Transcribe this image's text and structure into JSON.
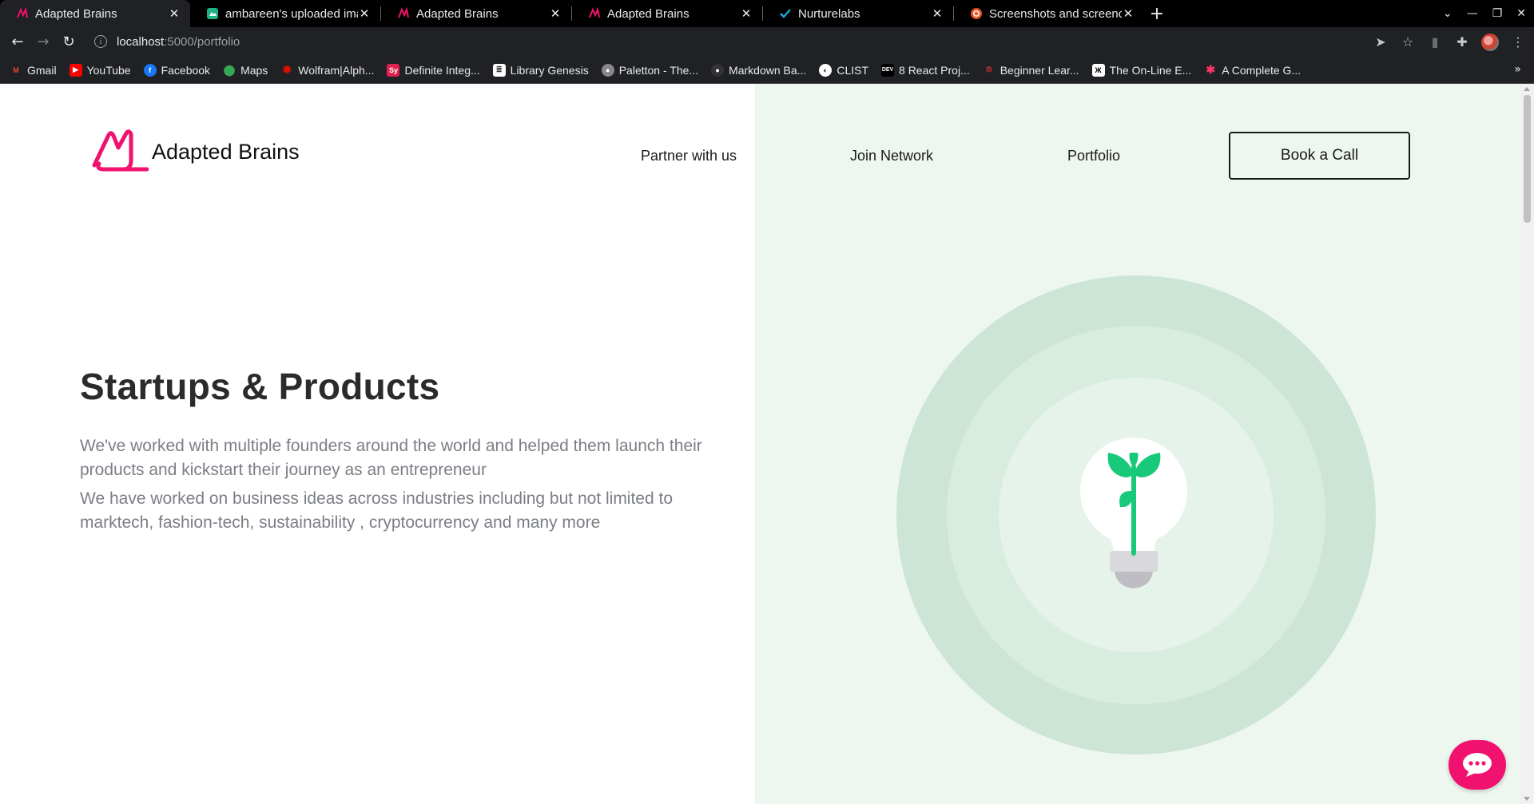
{
  "browser": {
    "tabs": [
      {
        "title": "Adapted Brains",
        "icon": "adapted-brains-icon",
        "active": true
      },
      {
        "title": "ambareen's uploaded ima",
        "icon": "uploaded-images-icon",
        "active": false
      },
      {
        "title": "Adapted Brains",
        "icon": "adapted-brains-icon",
        "active": false
      },
      {
        "title": "Adapted Brains",
        "icon": "adapted-brains-icon",
        "active": false
      },
      {
        "title": "Nurturelabs",
        "icon": "check-icon",
        "active": false
      },
      {
        "title": "Screenshots and screenca",
        "icon": "ubuntu-icon",
        "active": false
      }
    ],
    "url_host": "localhost",
    "url_path": ":5000/portfolio",
    "bookmarks": [
      {
        "label": "Gmail",
        "icon": "gmail-icon",
        "color": "#ea4335"
      },
      {
        "label": "YouTube",
        "icon": "youtube-icon",
        "color": "#ff0000"
      },
      {
        "label": "Facebook",
        "icon": "facebook-icon",
        "color": "#1877f2"
      },
      {
        "label": "Maps",
        "icon": "maps-icon",
        "color": "#34a853"
      },
      {
        "label": "Wolfram|Alph...",
        "icon": "wolfram-icon",
        "color": "#dd1100"
      },
      {
        "label": "Definite Integ...",
        "icon": "symbolab-icon",
        "color": "#e0204f"
      },
      {
        "label": "Library Genesis",
        "icon": "libgen-icon",
        "color": "#ffffff"
      },
      {
        "label": "Paletton - The...",
        "icon": "paletton-icon",
        "color": "#888888"
      },
      {
        "label": "Markdown Ba...",
        "icon": "github-icon",
        "color": "#333333"
      },
      {
        "label": "CLIST",
        "icon": "clist-icon",
        "color": "#ffffff"
      },
      {
        "label": "8 React Proj...",
        "icon": "dev-icon",
        "color": "#000000"
      },
      {
        "label": "Beginner Lear...",
        "icon": "codecademy-icon",
        "color": "#e03131"
      },
      {
        "label": "The On-Line E...",
        "icon": "oeis-icon",
        "color": "#ffffff"
      },
      {
        "label": "A Complete G...",
        "icon": "css-tricks-icon",
        "color": "#ff3366"
      }
    ]
  },
  "site": {
    "brand": "Adapted Brains",
    "accent_color": "#f0126e",
    "nav": {
      "partner": "Partner with us",
      "join": "Join Network",
      "portfolio": "Portfolio",
      "book_call": "Book a Call"
    },
    "hero": {
      "title": "Startups & Products",
      "paragraph1": "We've worked with multiple founders around the world and helped them launch their products and kickstart their journey as an entrepreneur",
      "paragraph2": "We have worked on business ideas across industries including but not limited to marktech, fashion-tech, sustainability , cryptocurrency and many more"
    },
    "illustration": {
      "icon": "lightbulb-sprout-icon",
      "panel_color": "#eef6f0"
    },
    "chat": {
      "icon": "chat-bubble-icon"
    }
  }
}
